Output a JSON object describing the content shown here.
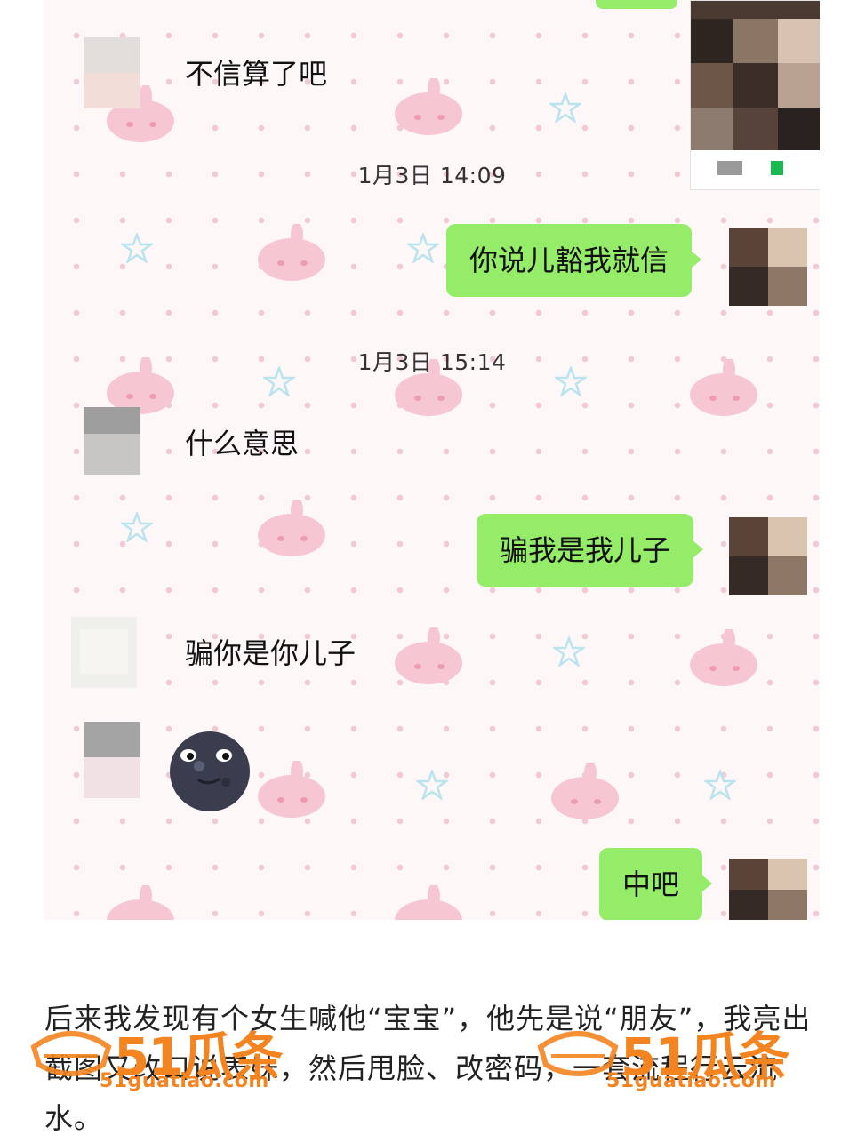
{
  "chat": {
    "messages": [
      {
        "id": "m1",
        "side": "left",
        "text": "不信算了吧"
      },
      {
        "id": "t1",
        "type": "time",
        "text": "1月3日 14:09"
      },
      {
        "id": "m2",
        "side": "right",
        "text": "你说儿豁我就信"
      },
      {
        "id": "t2",
        "type": "time",
        "text": "1月3日 15:14"
      },
      {
        "id": "m3",
        "side": "left",
        "text": "什么意思"
      },
      {
        "id": "m4",
        "side": "right",
        "text": "骗我是我儿子"
      },
      {
        "id": "m5",
        "side": "left",
        "text": "骗你是你儿子"
      },
      {
        "id": "m6",
        "side": "left",
        "type": "emoji",
        "icon": "new-moon-face-emoji"
      },
      {
        "id": "m7",
        "side": "right",
        "text": "中吧"
      }
    ]
  },
  "caption": {
    "text": "后来我发现有个女生喊他“宝宝”，他先是说“朋友”，我亮出截图又改口说表妹，然后甩脸、改密码，一套流程行云流水。"
  },
  "watermark": {
    "brand": "51瓜条",
    "url": "51guatiao.com",
    "color": "#f48420"
  },
  "colors": {
    "my_bubble": "#95ec69",
    "chat_bg": "#fdf7f8"
  }
}
